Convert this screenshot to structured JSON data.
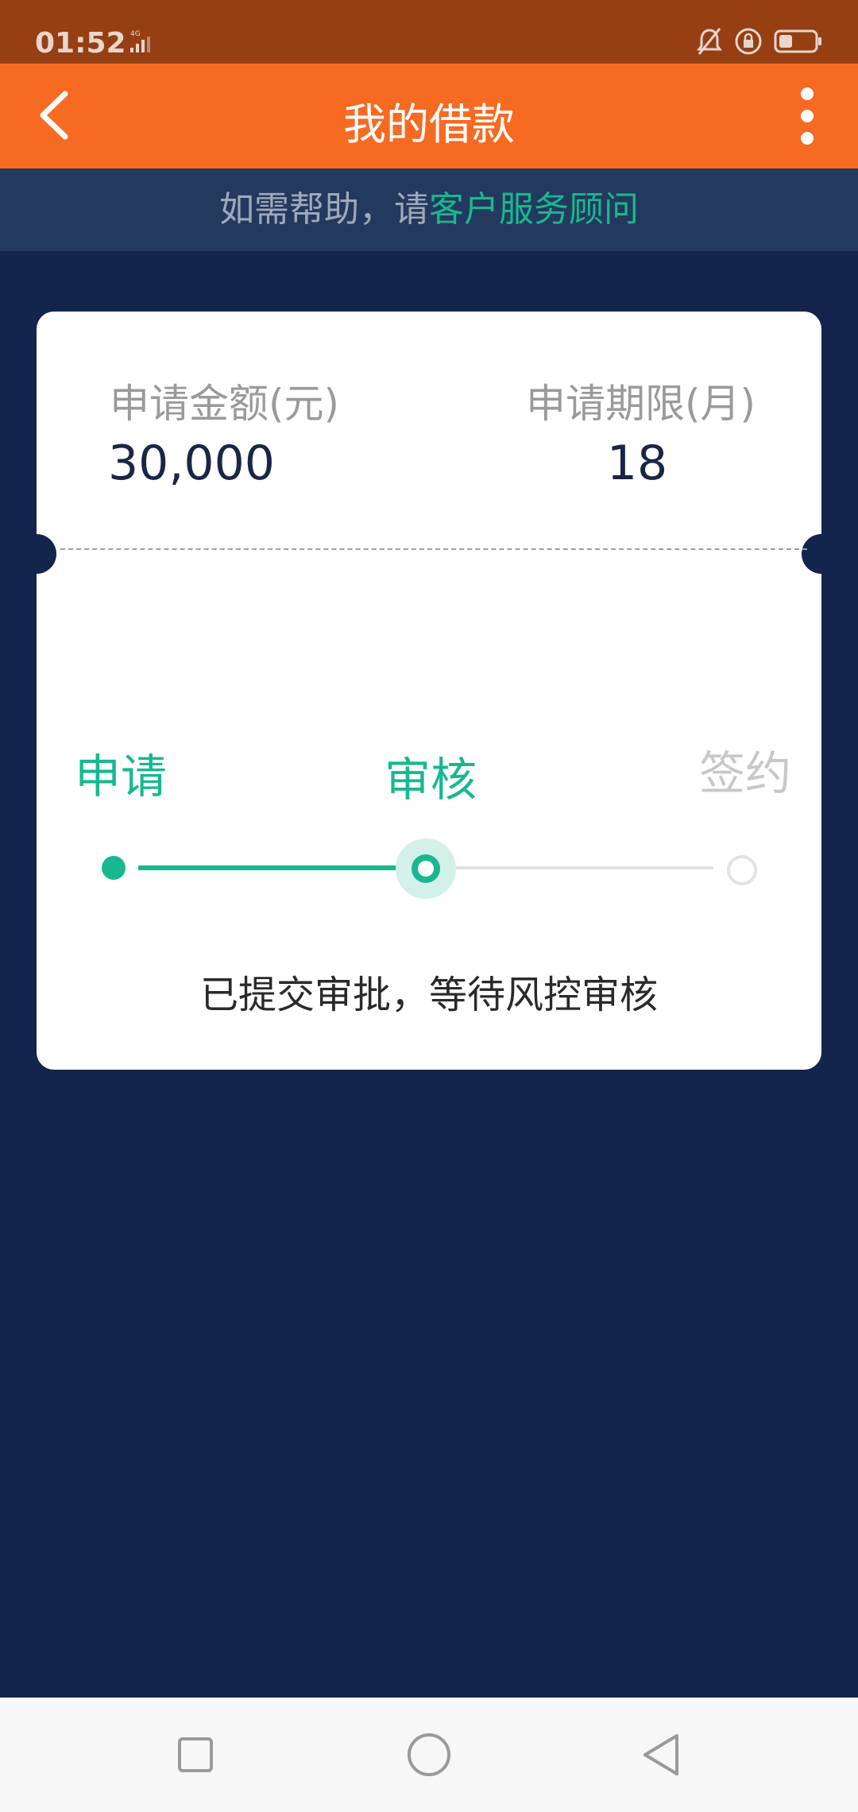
{
  "status_bar": {
    "time": "01:52",
    "network": "4G",
    "icons": [
      "mute-bell-icon",
      "lock-rotation-icon",
      "battery-icon"
    ]
  },
  "appbar": {
    "title": "我的借款",
    "back_icon": "chevron-left-icon",
    "more_icon": "more-vertical-icon"
  },
  "help": {
    "prefix": "如需帮助，请",
    "link": "客户服务顾问"
  },
  "loan": {
    "amount_label": "申请金额(元)",
    "amount_value": "30,000",
    "term_label": "申请期限(月)",
    "term_value": "18"
  },
  "progress": {
    "steps": [
      {
        "label": "申请",
        "state": "done"
      },
      {
        "label": "审核",
        "state": "current"
      },
      {
        "label": "签约",
        "state": "pending"
      }
    ],
    "message": "已提交审批，等待风控审核"
  },
  "colors": {
    "status_bar": "#963f13",
    "appbar": "#f76a22",
    "background": "#13244d",
    "accent": "#17b890"
  },
  "navbar": {
    "buttons": [
      "recent-apps-icon",
      "home-icon",
      "back-icon"
    ]
  }
}
